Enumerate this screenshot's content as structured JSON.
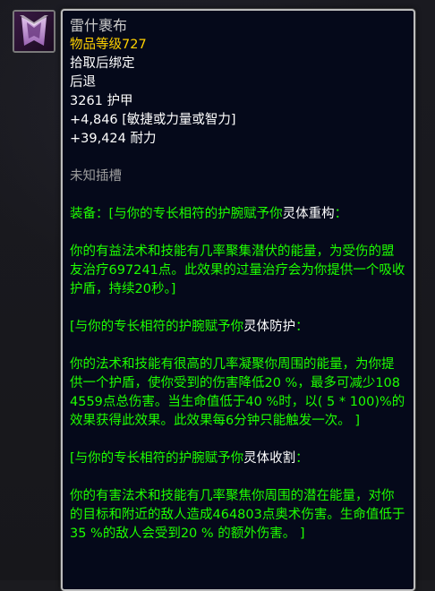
{
  "icon": "cloak-icon",
  "item": {
    "name": "雷什裹布",
    "item_level": "物品等级727",
    "binding": "拾取后绑定",
    "slot": "后退",
    "armor": "3261 护甲",
    "primary_stat": "+4,846 [敏捷或力量或智力]",
    "stamina": "+39,424 耐力",
    "socket": "未知插槽"
  },
  "effects": {
    "equip_prefix": "装备：[与你的专长相符的护腕赋予你",
    "equip_name": "灵体重构",
    "equip_suffix": "：",
    "equip_text": "你的有益法术和技能有几率聚集潜伏的能量，为受伤的盟友治疗697241点。此效果的过量治疗会为你提供一个吸收护盾，持续20秒。]",
    "block2_prefix": "[与你的专长相符的护腕赋予你",
    "block2_name": "灵体防护",
    "block2_suffix": "：",
    "block2_text": "你的法术和技能有很高的几率凝聚你周围的能量，为你提供一个护盾，使你受到的伤害降低20 %，最多可减少1084559点总伤害。当生命值低于40 %时，以( 5 * 100)%的效果获得此效果。此效果每6分钟只能触发一次。 ]",
    "block3_prefix": "[与你的专长相符的护腕赋予你",
    "block3_name": "灵体收割",
    "block3_suffix": "：",
    "block3_text": "你的有害法术和技能有几率聚焦你周围的潜在能量，对你的目标和附近的敌人造成464803点奥术伤害。生命值低于35 %的敌人会受到20 % 的额外伤害。 ]"
  },
  "colors": {
    "title": "#c9c9c9",
    "item_level": "#ffd100",
    "effect_green": "#1eff00",
    "muted": "#9d9d9d",
    "background": "#05091a"
  }
}
